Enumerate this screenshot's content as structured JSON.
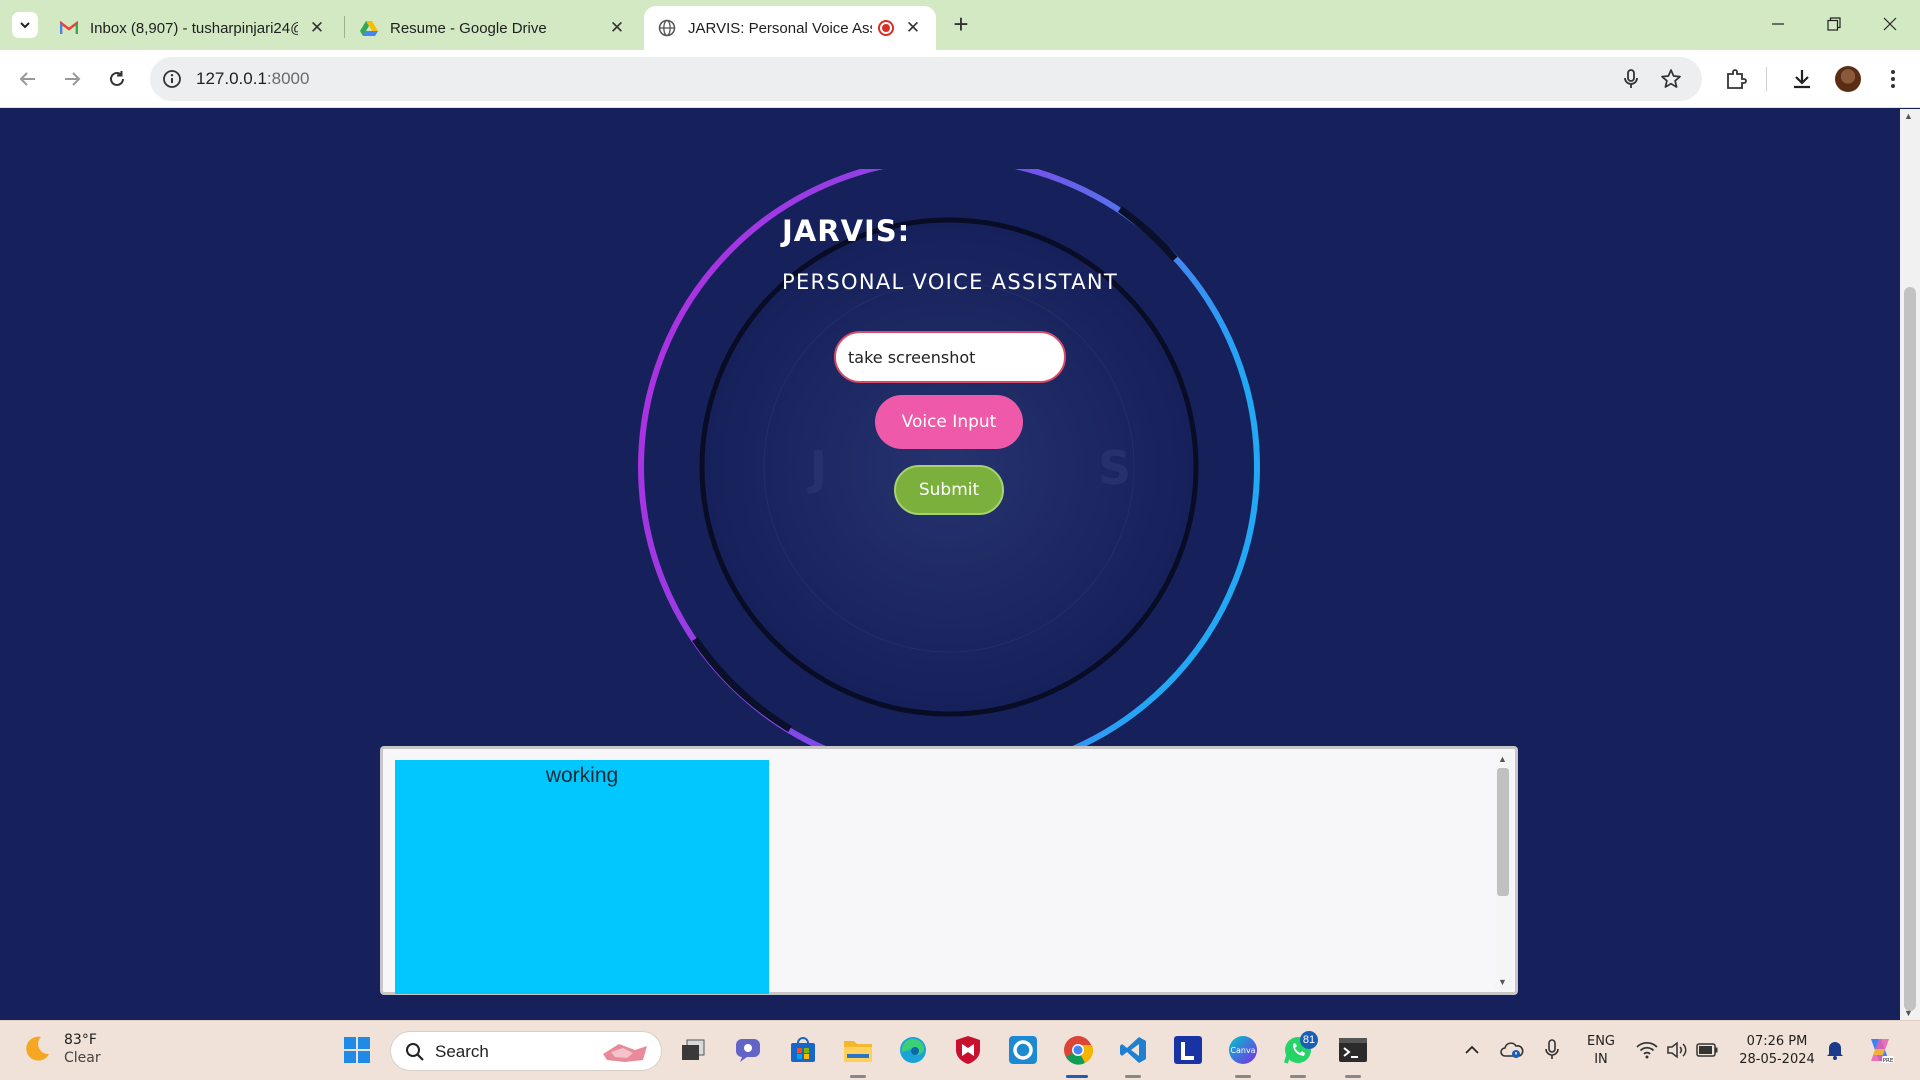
{
  "browser": {
    "tabs": [
      {
        "title": "Inbox (8,907) - tusharpinjari24@",
        "icon": "gmail-icon"
      },
      {
        "title": "Resume - Google Drive",
        "icon": "drive-icon"
      },
      {
        "title": "JARVIS: Personal Voice Assis",
        "icon": "globe-icon",
        "active": true
      }
    ],
    "address": {
      "host": "127.0.0.1",
      "port": ":8000"
    }
  },
  "page": {
    "title": "JARVIS:",
    "subtitle": "PERSONAL VOICE ASSISTANT",
    "command_input": {
      "value": "take screenshot"
    },
    "voice_button": "Voice Input",
    "submit_button": "Submit",
    "output_status": "working"
  },
  "taskbar": {
    "weather": {
      "temp": "83°F",
      "condition": "Clear"
    },
    "search_label": "Search",
    "whatsapp_badge": "81",
    "language": {
      "line1": "ENG",
      "line2": "IN"
    },
    "clock": {
      "time": "07:26 PM",
      "date": "28-05-2024"
    }
  },
  "colors": {
    "page_bg": "#16205a",
    "voice_button": "#ee5aa9",
    "submit_button": "#7bb03d",
    "output_tile": "#00c8fe",
    "tab_strip": "#d3e9c4"
  }
}
